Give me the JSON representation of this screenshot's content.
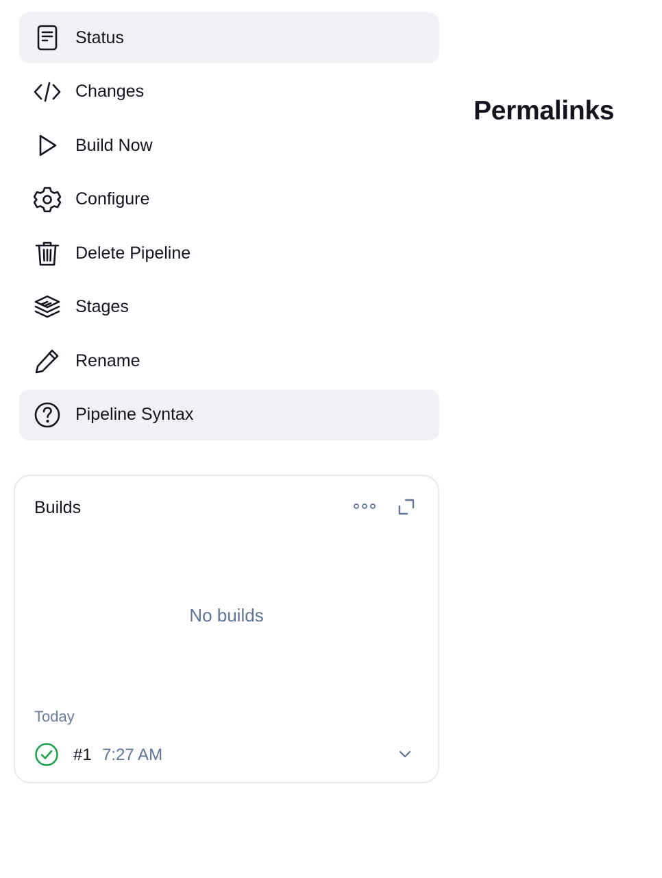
{
  "sidebar": {
    "items": [
      {
        "label": "Status",
        "icon": "document-icon",
        "active": true
      },
      {
        "label": "Changes",
        "icon": "code-icon",
        "active": false
      },
      {
        "label": "Build Now",
        "icon": "play-icon",
        "active": false
      },
      {
        "label": "Configure",
        "icon": "gear-icon",
        "active": false
      },
      {
        "label": "Delete Pipeline",
        "icon": "trash-icon",
        "active": false
      },
      {
        "label": "Stages",
        "icon": "layers-icon",
        "active": false
      },
      {
        "label": "Rename",
        "icon": "pencil-icon",
        "active": false
      },
      {
        "label": "Pipeline Syntax",
        "icon": "help-circle-icon",
        "active": true
      }
    ]
  },
  "main": {
    "heading": "Permalinks"
  },
  "builds": {
    "title": "Builds",
    "empty_text": "No builds",
    "day": "Today",
    "items": [
      {
        "number": "#1",
        "time": "7:27 AM",
        "status": "success",
        "status_icon": "check-circle-icon"
      }
    ]
  },
  "colors": {
    "text": "#14141f",
    "muted": "#5f7496",
    "active_bg": "#f1f1f5",
    "card_border": "#e8e8ee",
    "success": "#1ea446"
  }
}
